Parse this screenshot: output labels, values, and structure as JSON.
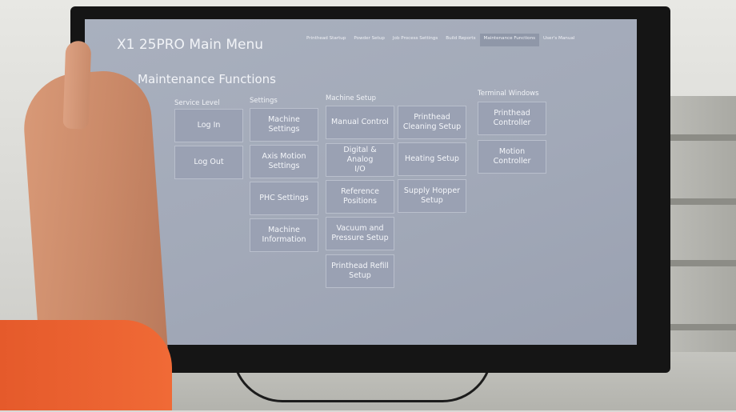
{
  "app": {
    "title": "X1 25PRO Main Menu"
  },
  "nav": {
    "tabs": [
      {
        "label": "Printhead Startup",
        "active": false
      },
      {
        "label": "Powder Setup",
        "active": false
      },
      {
        "label": "Job Process Settings",
        "active": false
      },
      {
        "label": "Build Reports",
        "active": false
      },
      {
        "label": "Maintenance Functions",
        "active": true
      },
      {
        "label": "User's Manual",
        "active": false
      }
    ]
  },
  "page": {
    "title": "Maintenance Functions"
  },
  "columns": {
    "service_level": "Service Level",
    "settings": "Settings",
    "machine_setup": "Machine Setup",
    "terminal_windows": "Terminal Windows"
  },
  "buttons": {
    "log_in": "Log In",
    "log_out": "Log Out",
    "machine_settings": "Machine Settings",
    "axis_motion_settings": "Axis Motion\nSettings",
    "phc_settings": "PHC Settings",
    "machine_information": "Machine\nInformation",
    "manual_control": "Manual Control",
    "digital_analog_io": "Digital & Analog\nI/O",
    "reference_positions": "Reference\nPositions",
    "vacuum_pressure_setup": "Vacuum and\nPressure Setup",
    "printhead_refill_setup": "Printhead Refill\nSetup",
    "printhead_cleaning_setup": "Printhead\nCleaning Setup",
    "heating_setup": "Heating Setup",
    "supply_hopper_setup": "Supply Hopper\nSetup",
    "printhead_controller": "Printhead\nController",
    "motion_controller": "Motion Controller"
  },
  "colors": {
    "screen_bg": "#a4abba",
    "button_bg": "#9aa1b3",
    "active_tab": "#8f97a8",
    "sleeve": "#ec6431"
  }
}
